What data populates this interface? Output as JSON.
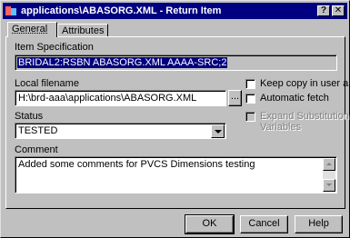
{
  "window": {
    "title": "applications\\ABASORG.XML - Return Item",
    "help_glyph": "?",
    "close_glyph": "✕"
  },
  "tabs": [
    {
      "label": "General",
      "active": true
    },
    {
      "label": "Attributes",
      "active": false
    }
  ],
  "general": {
    "item_spec_label": "Item Specification",
    "item_spec_value": "BRIDAL2:RSBN ABASORG.XML AAAA-SRC;2",
    "local_filename_label": "Local filename",
    "local_filename_value": "H:\\brd-aaa\\applications\\ABASORG.XML",
    "browse_label": "...",
    "status_label": "Status",
    "status_value": "TESTED",
    "comment_label": "Comment",
    "comment_value": "Added some comments for PVCS Dimensions testing",
    "options": [
      {
        "label": "Keep copy in user area",
        "checked": false,
        "enabled": true
      },
      {
        "label": "Automatic fetch",
        "checked": false,
        "enabled": true
      },
      {
        "label_line1": "Expand Substitution",
        "label_line2": "Variables",
        "checked": false,
        "enabled": false
      }
    ]
  },
  "buttons": {
    "ok": "OK",
    "cancel": "Cancel",
    "help": "Help"
  },
  "colors": {
    "titlebar": "#000080",
    "face": "#c0c0c0",
    "selection": "#000080"
  }
}
